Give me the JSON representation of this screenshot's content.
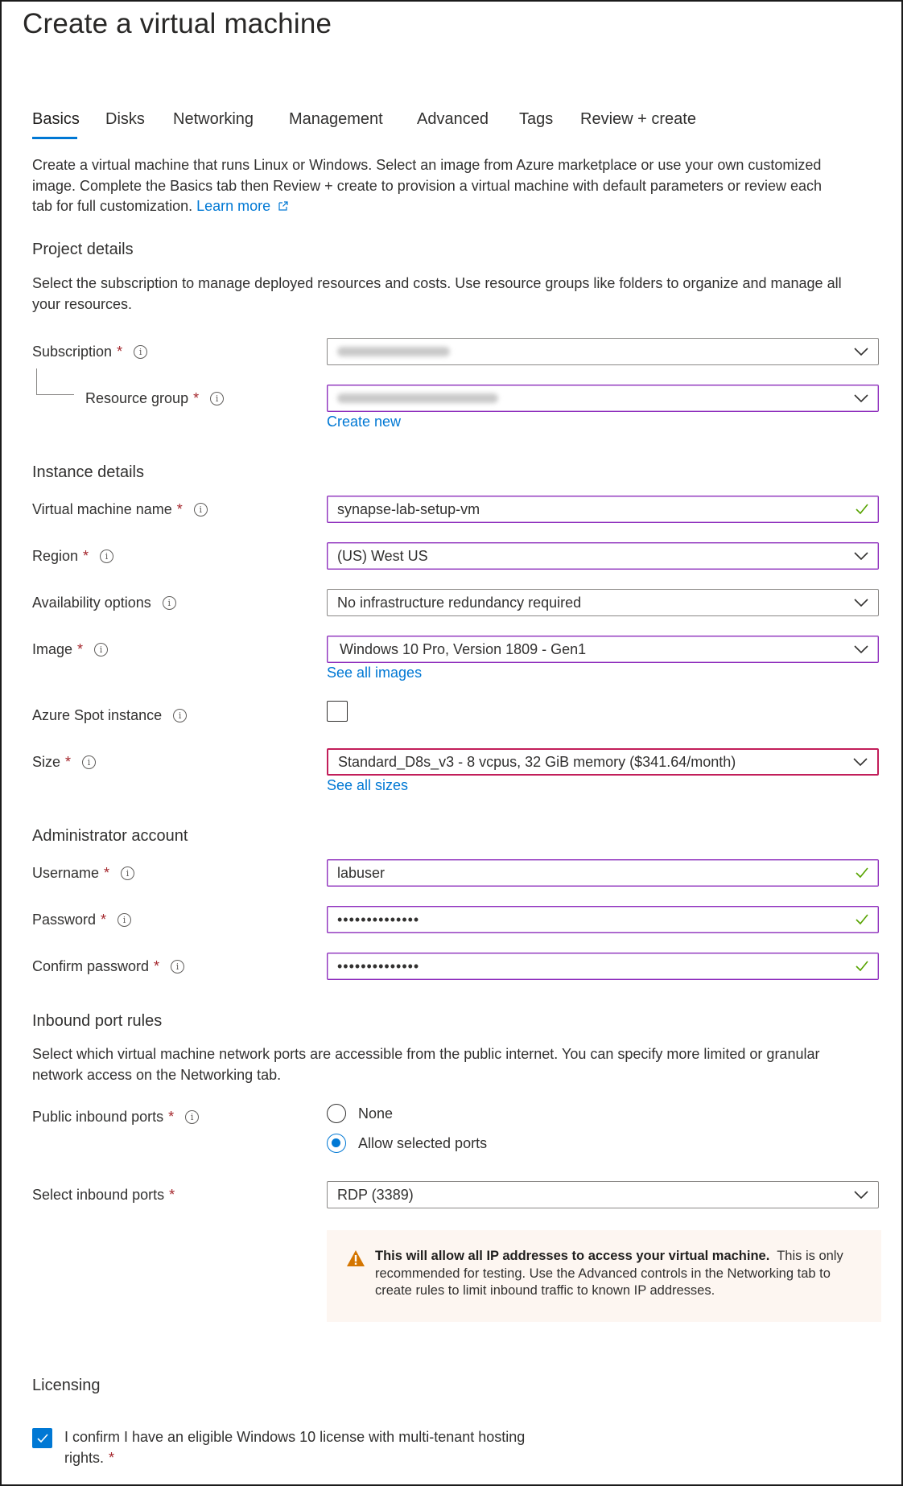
{
  "page": {
    "title": "Create a virtual machine"
  },
  "tabs": [
    {
      "label": "Basics",
      "active": true
    },
    {
      "label": "Disks",
      "active": false
    },
    {
      "label": "Networking",
      "active": false
    },
    {
      "label": "Management",
      "active": false
    },
    {
      "label": "Advanced",
      "active": false
    },
    {
      "label": "Tags",
      "active": false
    },
    {
      "label": "Review + create",
      "active": false
    }
  ],
  "intro": {
    "line1": "Create a virtual machine that runs Linux or Windows. Select an image from Azure marketplace or use your own customized",
    "line2": "image. Complete the Basics tab then Review + create to provision a virtual machine with default parameters or review each",
    "line3": "tab for full customization.",
    "learn_more": "Learn more"
  },
  "project_details": {
    "heading": "Project details",
    "desc_line1": "Select the subscription to manage deployed resources and costs. Use resource groups like folders to organize and manage all",
    "desc_line2": "your resources.",
    "subscription": {
      "label": "Subscription",
      "value_redacted": true
    },
    "resource_group": {
      "label": "Resource group",
      "value_redacted": true,
      "create_new": "Create new"
    }
  },
  "instance_details": {
    "heading": "Instance details",
    "vm_name": {
      "label": "Virtual machine name",
      "value": "synapse-lab-setup-vm",
      "valid": true
    },
    "region": {
      "label": "Region",
      "value": "(US) West US"
    },
    "availability": {
      "label": "Availability options",
      "value": "No infrastructure redundancy required"
    },
    "image": {
      "label": "Image",
      "value": "Windows 10 Pro, Version 1809 - Gen1",
      "link": "See all images"
    },
    "spot": {
      "label": "Azure Spot instance",
      "checked": false
    },
    "size": {
      "label": "Size",
      "value": "Standard_D8s_v3 - 8 vcpus, 32 GiB memory ($341.64/month)",
      "link": "See all sizes"
    }
  },
  "admin_account": {
    "heading": "Administrator account",
    "username": {
      "label": "Username",
      "value": "labuser",
      "valid": true
    },
    "password": {
      "label": "Password",
      "value": "••••••••••••••",
      "valid": true
    },
    "confirm_password": {
      "label": "Confirm password",
      "value": "••••••••••••••",
      "valid": true
    }
  },
  "inbound_rules": {
    "heading": "Inbound port rules",
    "desc_line1": "Select which virtual machine network ports are accessible from the public internet. You can specify more limited or granular",
    "desc_line2": "network access on the Networking tab.",
    "public_ports": {
      "label": "Public inbound ports",
      "options": [
        {
          "label": "None",
          "selected": false
        },
        {
          "label": "Allow selected ports",
          "selected": true
        }
      ]
    },
    "select_ports": {
      "label": "Select inbound ports",
      "value": "RDP (3389)"
    },
    "warning": {
      "bold": "This will allow all IP addresses to access your virtual machine.",
      "text": "This is only recommended for testing.  Use the Advanced controls in the Networking tab to create rules to limit inbound traffic to known IP addresses."
    }
  },
  "licensing": {
    "heading": "Licensing",
    "confirm_line1": "I confirm I have an eligible Windows 10 license with multi-tenant hosting",
    "confirm_line2": "rights.",
    "checked": true
  },
  "common": {
    "required_mark": "*",
    "info_glyph": "i"
  },
  "colors": {
    "accent": "#0078d4",
    "focus_border": "#8f2ebd",
    "error_border": "#c21e5a",
    "valid_check": "#57a300",
    "required": "#a4262c",
    "warning_bg": "#fdf6f1",
    "warning_icon": "#d47500"
  }
}
